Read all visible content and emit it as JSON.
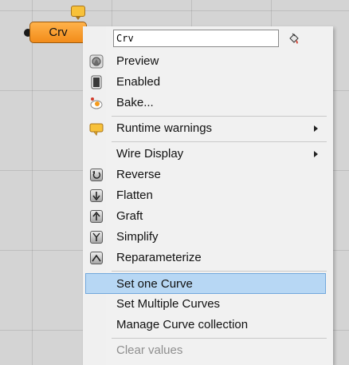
{
  "component": {
    "label": "Crv"
  },
  "rename": {
    "value": "Crv"
  },
  "menu": {
    "items": [
      {
        "label": "Preview",
        "icon": "preview-icon"
      },
      {
        "label": "Enabled",
        "icon": "enabled-icon"
      },
      {
        "label": "Bake...",
        "icon": "bake-icon"
      },
      {
        "label": "Runtime warnings",
        "icon": "warning-bubble-icon"
      },
      {
        "label": "Wire Display"
      },
      {
        "label": "Reverse",
        "icon": "reverse-icon"
      },
      {
        "label": "Flatten",
        "icon": "flatten-icon"
      },
      {
        "label": "Graft",
        "icon": "graft-icon"
      },
      {
        "label": "Simplify",
        "icon": "simplify-icon"
      },
      {
        "label": "Reparameterize",
        "icon": "reparameterize-icon"
      },
      {
        "label": "Set one Curve",
        "state": "highlighted"
      },
      {
        "label": "Set Multiple Curves"
      },
      {
        "label": "Manage Curve collection"
      },
      {
        "label": "Clear values",
        "state": "disabled"
      }
    ]
  },
  "colors": {
    "canvas": "#d4d4d4",
    "component": "#f7a13a",
    "highlight": "#b7d7f4",
    "menu_bg": "#f1f1f1"
  }
}
